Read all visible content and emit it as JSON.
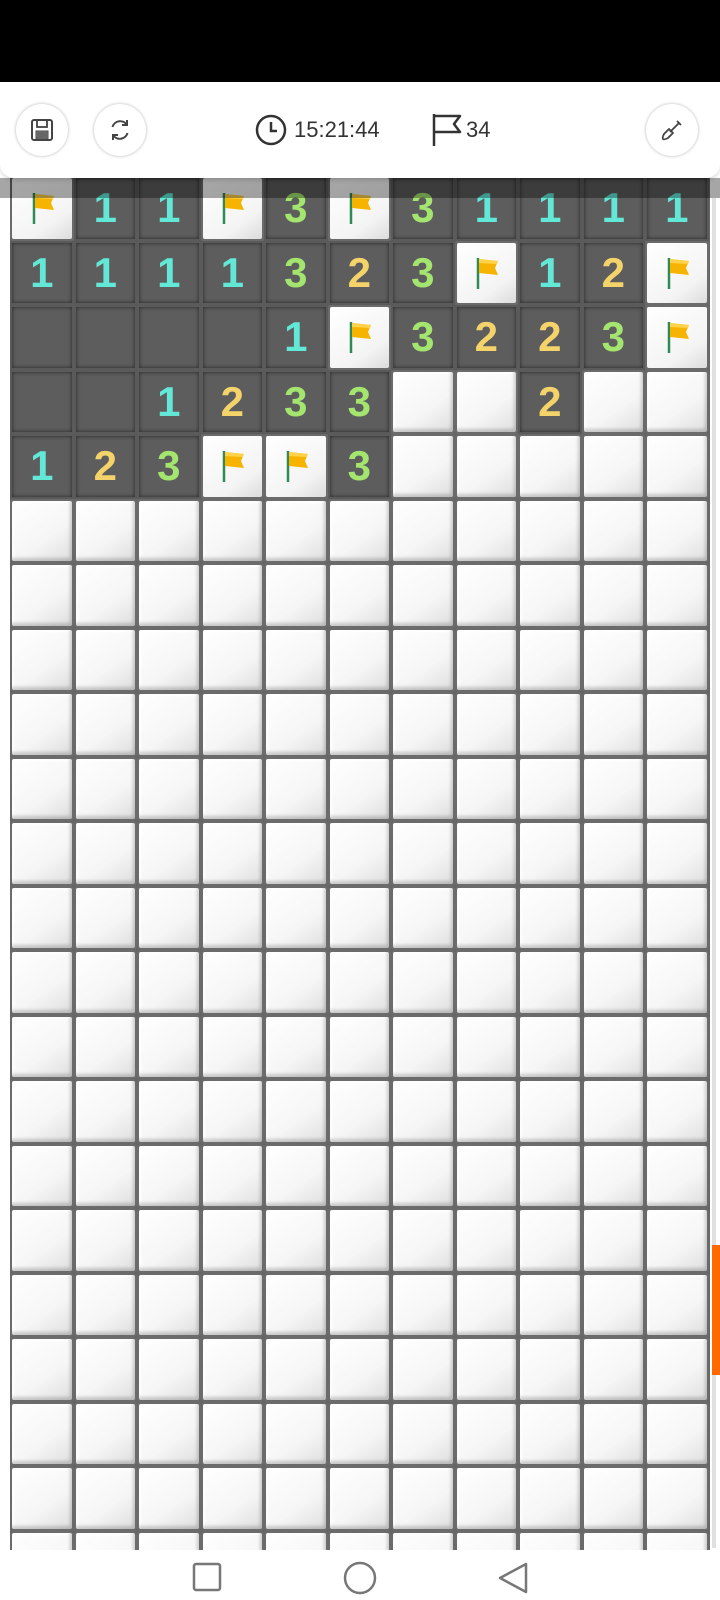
{
  "toolbar": {
    "timer": "15:21:44",
    "flag_count": "34"
  },
  "board": {
    "rows": [
      [
        "F",
        "1",
        "1",
        "F",
        "3",
        "F",
        "3",
        "1",
        "1",
        "1",
        "1"
      ],
      [
        "1",
        "1",
        "1",
        "1",
        "3",
        "2",
        "3",
        "F",
        "1",
        "2",
        "F"
      ],
      [
        "0",
        "0",
        "0",
        "0",
        "1",
        "F",
        "3",
        "2",
        "2",
        "3",
        "F"
      ],
      [
        "0",
        "0",
        "1",
        "2",
        "3",
        "3",
        "C",
        "C",
        "2",
        "C",
        "C"
      ],
      [
        "1",
        "2",
        "3",
        "F",
        "F",
        "3",
        "C",
        "C",
        "C",
        "C",
        "C"
      ],
      [
        "C",
        "C",
        "C",
        "C",
        "C",
        "C",
        "C",
        "C",
        "C",
        "C",
        "C"
      ],
      [
        "C",
        "C",
        "C",
        "C",
        "C",
        "C",
        "C",
        "C",
        "C",
        "C",
        "C"
      ],
      [
        "C",
        "C",
        "C",
        "C",
        "C",
        "C",
        "C",
        "C",
        "C",
        "C",
        "C"
      ],
      [
        "C",
        "C",
        "C",
        "C",
        "C",
        "C",
        "C",
        "C",
        "C",
        "C",
        "C"
      ],
      [
        "C",
        "C",
        "C",
        "C",
        "C",
        "C",
        "C",
        "C",
        "C",
        "C",
        "C"
      ],
      [
        "C",
        "C",
        "C",
        "C",
        "C",
        "C",
        "C",
        "C",
        "C",
        "C",
        "C"
      ],
      [
        "C",
        "C",
        "C",
        "C",
        "C",
        "C",
        "C",
        "C",
        "C",
        "C",
        "C"
      ],
      [
        "C",
        "C",
        "C",
        "C",
        "C",
        "C",
        "C",
        "C",
        "C",
        "C",
        "C"
      ],
      [
        "C",
        "C",
        "C",
        "C",
        "C",
        "C",
        "C",
        "C",
        "C",
        "C",
        "C"
      ],
      [
        "C",
        "C",
        "C",
        "C",
        "C",
        "C",
        "C",
        "C",
        "C",
        "C",
        "C"
      ],
      [
        "C",
        "C",
        "C",
        "C",
        "C",
        "C",
        "C",
        "C",
        "C",
        "C",
        "C"
      ],
      [
        "C",
        "C",
        "C",
        "C",
        "C",
        "C",
        "C",
        "C",
        "C",
        "C",
        "C"
      ],
      [
        "C",
        "C",
        "C",
        "C",
        "C",
        "C",
        "C",
        "C",
        "C",
        "C",
        "C"
      ],
      [
        "C",
        "C",
        "C",
        "C",
        "C",
        "C",
        "C",
        "C",
        "C",
        "C",
        "C"
      ],
      [
        "C",
        "C",
        "C",
        "C",
        "C",
        "C",
        "C",
        "C",
        "C",
        "C",
        "C"
      ],
      [
        "C",
        "C",
        "C",
        "C",
        "C",
        "C",
        "C",
        "C",
        "C",
        "C",
        "C"
      ],
      [
        "C",
        "C",
        "C",
        "C",
        "C",
        "C",
        "C",
        "C",
        "C",
        "C",
        "C"
      ]
    ],
    "colors": {
      "1": "#63e8d8",
      "2": "#f4d36a",
      "3": "#a3e56f",
      "flag": "#f6b400",
      "scroll_thumb": "#ff6a00"
    }
  },
  "icons": {
    "save": "floppy-disk-icon",
    "restart": "refresh-icon",
    "timer": "clock-icon",
    "flags": "flag-outline-icon",
    "tool": "shovel-icon",
    "nav_recent": "square-icon",
    "nav_home": "circle-icon",
    "nav_back": "triangle-back-icon"
  }
}
